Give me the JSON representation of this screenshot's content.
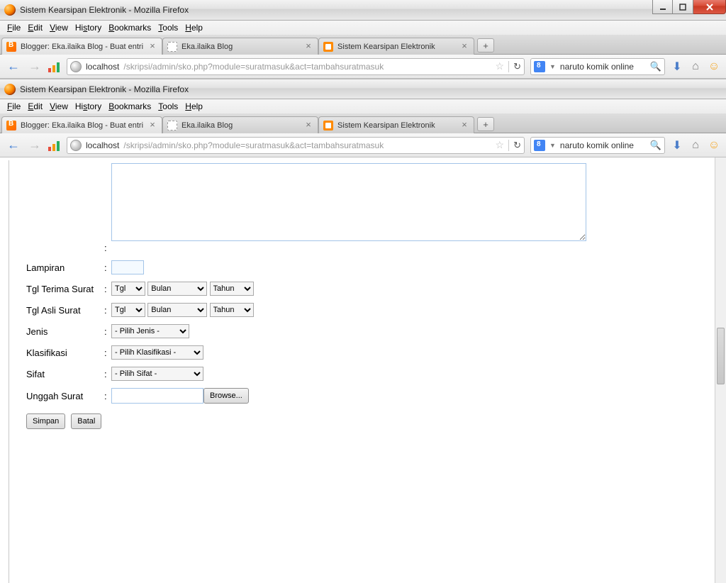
{
  "window_title": "Sistem Kearsipan Elektronik - Mozilla Firefox",
  "menubar": {
    "file": "File",
    "edit": "Edit",
    "view": "View",
    "history": "History",
    "bookmarks": "Bookmarks",
    "tools": "Tools",
    "help": "Help"
  },
  "tabs": [
    {
      "label": "Blogger: Eka.ilaika Blog - Buat entri"
    },
    {
      "label": "Eka.ilaika Blog"
    },
    {
      "label": "Sistem Kearsipan Elektronik"
    }
  ],
  "newtab_symbol": "+",
  "url": {
    "host": "localhost",
    "path": "/skripsi/admin/sko.php?module=suratmasuk&act=tambahsuratmasuk"
  },
  "search": {
    "query": "naruto komik online"
  },
  "form": {
    "lampiran_label": "Lampiran",
    "tgl_terima_label": "Tgl Terima Surat",
    "tgl_asli_label": "Tgl Asli Surat",
    "jenis_label": "Jenis",
    "klasifikasi_label": "Klasifikasi",
    "sifat_label": "Sifat",
    "unggah_label": "Unggah Surat",
    "selects": {
      "tgl": "Tgl",
      "bulan": "Bulan",
      "tahun": "Tahun",
      "jenis": "- Pilih Jenis -",
      "klasifikasi": "- Pilih Klasifikasi -",
      "sifat": "- Pilih Sifat -"
    },
    "browse_btn": "Browse...",
    "simpan_btn": "Simpan",
    "batal_btn": "Batal",
    "colon": ":"
  }
}
